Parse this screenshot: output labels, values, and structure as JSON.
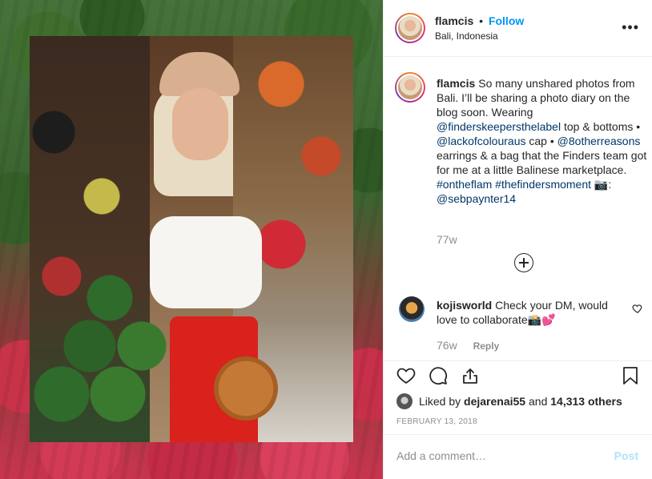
{
  "post": {
    "username": "flamcis",
    "follow_label": "Follow",
    "separator": "•",
    "location": "Bali, Indonesia",
    "more_icon": "more-horizontal-icon"
  },
  "caption": {
    "username": "flamcis",
    "text_1": "So many unshared photos from Bali. I’ll be sharing a photo diary on the blog soon. Wearing ",
    "tag_1": "@finderskeepersthelabel",
    "text_2": " top & bottoms • ",
    "tag_2": "@lackofcolouraus",
    "text_3": " cap • ",
    "tag_3": "@8otherreasons",
    "text_4": " earrings & a bag that the Finders team got for me at a little Balinese marketplace. ",
    "tag_4": "#ontheflam",
    "text_5": " ",
    "tag_5": "#thefindersmoment",
    "text_6": " 📷: ",
    "tag_6": "@sebpaynter14",
    "time": "77w"
  },
  "comment": {
    "username": "kojisworld",
    "text": "Check your DM, would love to collaborate📸💕",
    "time": "76w",
    "reply_label": "Reply"
  },
  "stats": {
    "liked_by_prefix": "Liked by ",
    "liked_by_user": "dejarenai55",
    "and": " and ",
    "others": "14,313 others",
    "date": "FEBRUARY 13, 2018"
  },
  "composer": {
    "placeholder": "Add a comment…",
    "post_label": "Post"
  },
  "colors": {
    "follow": "#0095f6",
    "hashtag": "#00376b",
    "muted": "#8e8e8e",
    "post_disabled": "#b2dffc"
  }
}
